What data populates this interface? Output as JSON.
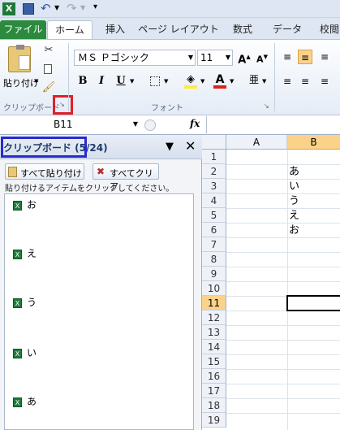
{
  "tabs": {
    "file": "ファイル",
    "home": "ホーム",
    "insert": "挿入",
    "page_layout": "ページ レイアウト",
    "formulas": "数式",
    "data": "データ",
    "review": "校閲"
  },
  "ribbon": {
    "paste_label": "貼り付け",
    "clipboard_group": "クリップボード",
    "font_group": "フォント",
    "font_name": "ＭＳ Ｐゴシック",
    "font_size": "11",
    "bold": "B",
    "italic": "I",
    "underline": "U",
    "font_color_letter": "A"
  },
  "formula_bar": {
    "name_box": "B11",
    "fx": "fx"
  },
  "clipboard_pane": {
    "title": "クリップボード (5/24)",
    "paste_all": "すべて貼り付け",
    "clear_all": "すべてクリア",
    "hint": "貼り付けるアイテムをクリックしてください。",
    "items": [
      "お",
      "え",
      "う",
      "い",
      "あ"
    ]
  },
  "sheet": {
    "col_a": "A",
    "col_b": "B",
    "rows": [
      "1",
      "2",
      "3",
      "4",
      "5",
      "6",
      "7",
      "8",
      "9",
      "10",
      "11",
      "12",
      "13",
      "14",
      "15",
      "16",
      "17",
      "18",
      "19"
    ],
    "values_b": [
      "",
      "あ",
      "い",
      "う",
      "え",
      "お"
    ]
  },
  "colors": {
    "file_tab": "#2b8a3e",
    "selected_row": "#fbd28a",
    "red_highlight": "#e0202a",
    "blue_highlight": "#2a2ad0"
  }
}
